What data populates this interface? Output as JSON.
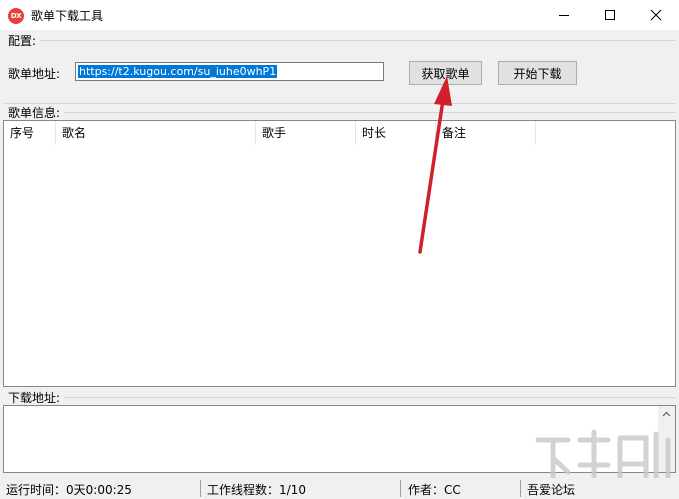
{
  "window": {
    "title": "歌单下载工具",
    "app_icon_text": "DX"
  },
  "config": {
    "section_label": "配置:",
    "url_label": "歌单地址:",
    "url_value": "https://t2.kugou.com/su_iuhe0whP1",
    "fetch_button": "获取歌单",
    "start_button": "开始下载"
  },
  "playlist": {
    "section_label": "歌单信息:",
    "columns": [
      "序号",
      "歌名",
      "歌手",
      "时长",
      "备注"
    ]
  },
  "download": {
    "section_label": "下载地址:"
  },
  "status": {
    "runtime": "运行时间：0天0:00:25",
    "threads": "工作线程数：1/10",
    "author": "作者：CC",
    "forum": "吾爱论坛"
  },
  "colors": {
    "selection": "#0078d7",
    "arrow": "#d0202a",
    "icon": "#e8413a"
  },
  "icons": {
    "minimize": "minimize-icon",
    "maximize": "maximize-icon",
    "close": "close-icon",
    "scroll_up": "chevron-up-icon"
  }
}
